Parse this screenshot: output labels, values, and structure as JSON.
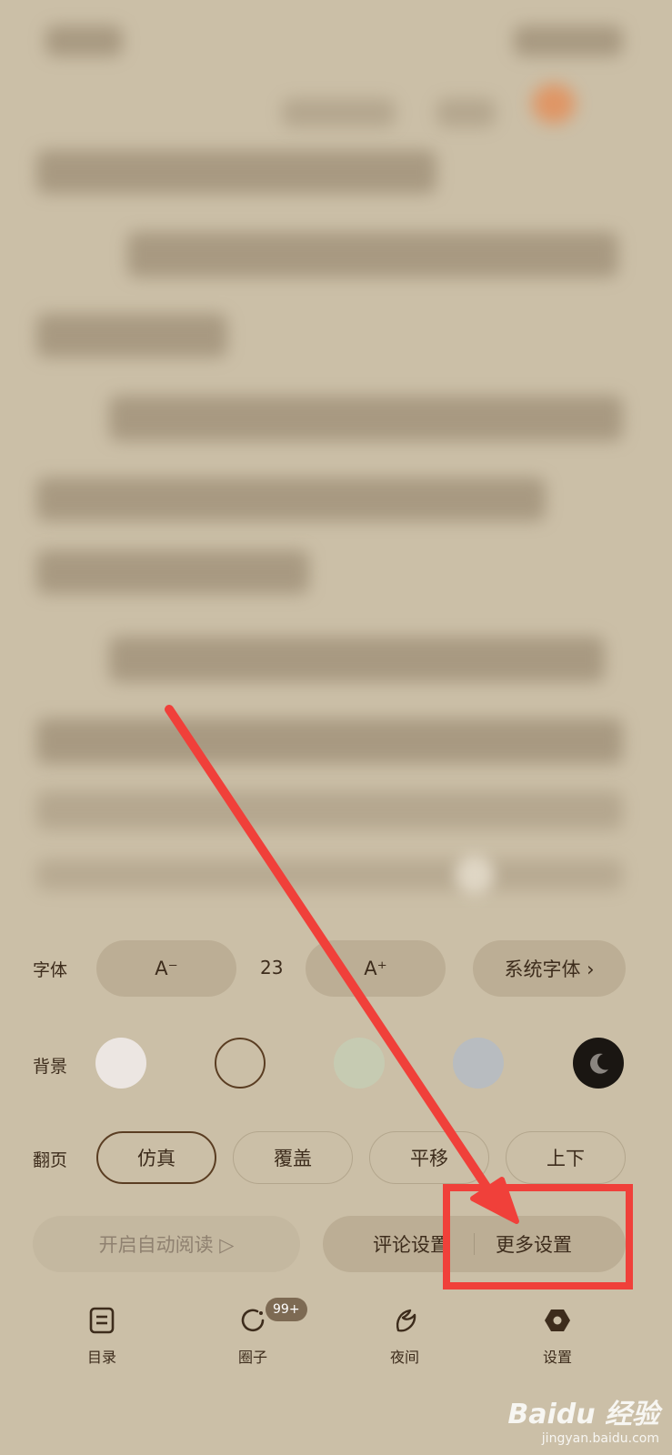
{
  "font_row": {
    "label": "字体",
    "decrease_label": "A⁻",
    "size_value": "23",
    "increase_label": "A⁺",
    "font_family_label": "系统字体 ›"
  },
  "background_row": {
    "label": "背景",
    "swatches": [
      {
        "color": "#ece6e2",
        "selected": false
      },
      {
        "color": "#cbbfa7",
        "selected": true
      },
      {
        "color": "#c6cbb2",
        "selected": false
      },
      {
        "color": "#b8bcc0",
        "selected": false
      },
      {
        "color": "#1a1612",
        "selected": false,
        "icon": "moon-icon"
      }
    ]
  },
  "page_turn_row": {
    "label": "翻页",
    "options": [
      "仿真",
      "覆盖",
      "平移",
      "上下"
    ],
    "selected": "仿真"
  },
  "actions": {
    "auto_read": "开启自动阅读 ▷",
    "comment_settings": "评论设置",
    "more_settings": "更多设置"
  },
  "bottom_nav": {
    "items": [
      {
        "label": "目录",
        "icon": "toc-icon"
      },
      {
        "label": "圈子",
        "icon": "circle-icon",
        "badge": "99+"
      },
      {
        "label": "夜间",
        "icon": "moon-icon"
      },
      {
        "label": "设置",
        "icon": "settings-icon"
      }
    ]
  },
  "watermark": {
    "brand": "Baidu 经验",
    "site": "jingyan.baidu.com"
  },
  "colors": {
    "annotation_red": "#f0403a",
    "accent_brown": "#5a3d22"
  }
}
